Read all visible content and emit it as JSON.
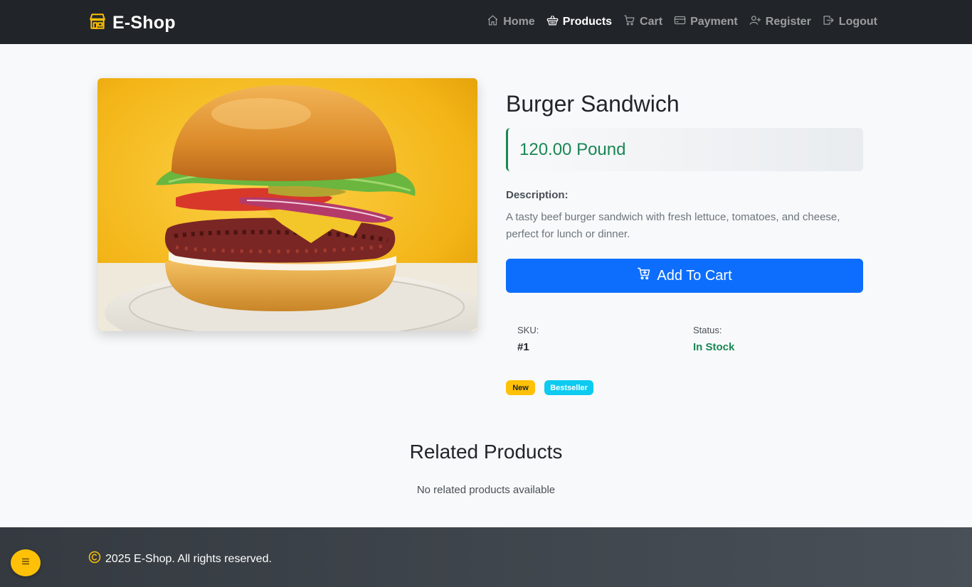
{
  "brand": {
    "name": "E-Shop",
    "icon": "shop-icon",
    "icon_color": "#ffc107"
  },
  "nav": {
    "items": [
      {
        "label": "Home",
        "icon": "house-icon",
        "active": false
      },
      {
        "label": "Products",
        "icon": "basket-icon",
        "active": true
      },
      {
        "label": "Cart",
        "icon": "cart-icon",
        "active": false
      },
      {
        "label": "Payment",
        "icon": "credit-card-icon",
        "active": false
      },
      {
        "label": "Register",
        "icon": "person-plus-icon",
        "active": false
      },
      {
        "label": "Logout",
        "icon": "box-arrow-right-icon",
        "active": false
      }
    ]
  },
  "product": {
    "name": "Burger Sandwich",
    "price": "120.00 Pound",
    "description_label": "Description:",
    "description": "A tasty beef burger sandwich with fresh lettuce, tomatoes, and cheese, perfect for lunch or dinner.",
    "add_to_cart_label": "Add To Cart",
    "sku_label": "SKU:",
    "sku_value": "#1",
    "status_label": "Status:",
    "status_value": "In Stock",
    "badges": [
      {
        "label": "New",
        "color": "#ffc107"
      },
      {
        "label": "Bestseller",
        "color": "#0dcaf0"
      }
    ]
  },
  "related": {
    "title": "Related Products",
    "empty_text": "No related products available"
  },
  "footer": {
    "copyright": "2025 E-Shop. All rights reserved."
  },
  "colors": {
    "navbar": "#212529",
    "accent": "#0d6efd",
    "success": "#198754",
    "warning": "#ffc107",
    "info": "#0dcaf0"
  }
}
